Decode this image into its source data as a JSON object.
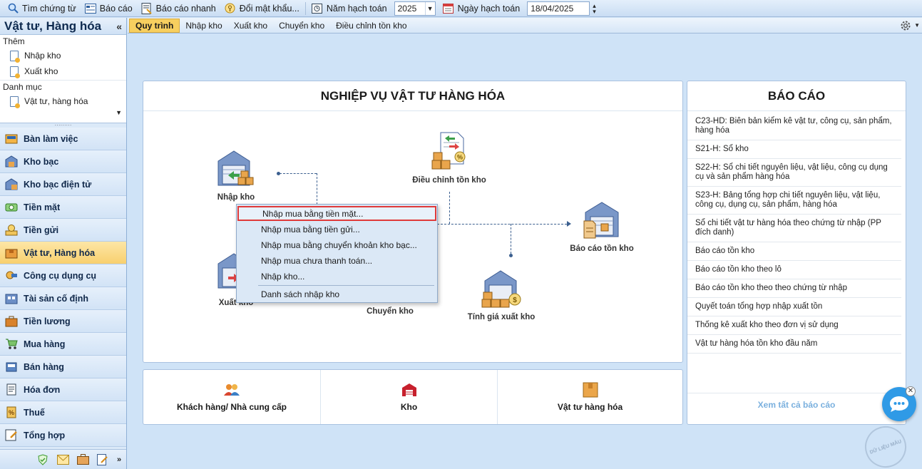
{
  "toolbar": {
    "items": [
      "Tìm chứng từ",
      "Báo cáo",
      "Báo cáo nhanh",
      "Đổi mật khẩu..."
    ],
    "fiscal_year_label": "Năm hạch toán",
    "fiscal_year_value": "2025",
    "posting_date_label": "Ngày hạch toán",
    "posting_date_value": "18/04/2025"
  },
  "sidebar": {
    "title": "Vật tư, Hàng hóa",
    "collapse_glyph": "«",
    "add_group": "Thêm",
    "add_items": [
      "Nhập kho",
      "Xuất kho"
    ],
    "catalog_group": "Danh mục",
    "catalog_items": [
      "Vật tư, hàng hóa"
    ],
    "nav": [
      {
        "label": "Bàn làm việc",
        "icon": "desk-icon"
      },
      {
        "label": "Kho bạc",
        "icon": "treasury-icon"
      },
      {
        "label": "Kho bạc điện tử",
        "icon": "e-treasury-icon"
      },
      {
        "label": "Tiền mặt",
        "icon": "cash-icon"
      },
      {
        "label": "Tiền gửi",
        "icon": "deposit-icon"
      },
      {
        "label": "Vật tư, Hàng hóa",
        "icon": "inventory-icon",
        "active": true
      },
      {
        "label": "Công cụ dụng cụ",
        "icon": "tools-icon"
      },
      {
        "label": "Tài sản cố định",
        "icon": "fixed-asset-icon"
      },
      {
        "label": "Tiền lương",
        "icon": "salary-icon"
      },
      {
        "label": "Mua hàng",
        "icon": "cart-icon"
      },
      {
        "label": "Bán hàng",
        "icon": "sales-icon"
      },
      {
        "label": "Hóa đơn",
        "icon": "invoice-icon"
      },
      {
        "label": "Thuế",
        "icon": "tax-icon"
      },
      {
        "label": "Tổng hợp",
        "icon": "summary-icon"
      }
    ]
  },
  "tabs": [
    "Quy trình",
    "Nhập kho",
    "Xuất kho",
    "Chuyển kho",
    "Điều chỉnh tồn kho"
  ],
  "process": {
    "title": "NGHIỆP VỤ VẬT TƯ HÀNG HÓA",
    "nodes": {
      "nhap_kho": "Nhập kho",
      "dieu_chinh": "Điều chỉnh tồn kho",
      "bao_cao_ton": "Báo cáo tồn kho",
      "xuat_kho": "Xuất kho",
      "chuyen_kho": "Chuyển kho",
      "tinh_gia": "Tính giá xuất kho"
    }
  },
  "shortcuts": [
    "Khách hàng/ Nhà cung cấp",
    "Kho",
    "Vật tư hàng hóa"
  ],
  "reports": {
    "title": "BÁO CÁO",
    "items": [
      "C23-HD: Biên bản kiểm kê vật tư, công cụ, sản phẩm, hàng hóa",
      "S21-H: Sổ kho",
      "S22-H: Sổ chi tiết nguyên liệu, vật liệu, công cụ dụng cụ và sản phẩm hàng hóa",
      "S23-H: Bảng tổng hợp chi tiết nguyên liệu, vật liệu, công cụ, dụng cụ, sản phẩm, hàng hóa",
      "Sổ chi tiết vật tư hàng hóa theo chứng từ nhập (PP đích danh)",
      "Báo cáo tồn kho",
      "Báo cáo tồn kho theo lô",
      "Báo cáo tồn kho theo theo chứng từ nhập",
      "Quyết toán tổng hợp nhập xuất tồn",
      "Thống kê xuất kho theo đơn vị sử dụng",
      "Vật tư hàng hóa tồn kho đầu năm"
    ],
    "view_all": "Xem tất cả báo cáo"
  },
  "context_menu": {
    "items": [
      "Nhập mua bằng tiền mặt...",
      "Nhập mua bằng tiền gửi...",
      "Nhập mua bằng chuyển khoản kho bạc...",
      "Nhập mua chưa thanh toán...",
      "Nhập kho...",
      "Danh sách nhập kho"
    ]
  },
  "stamp_text": "DỮ LIỆU MẪU"
}
